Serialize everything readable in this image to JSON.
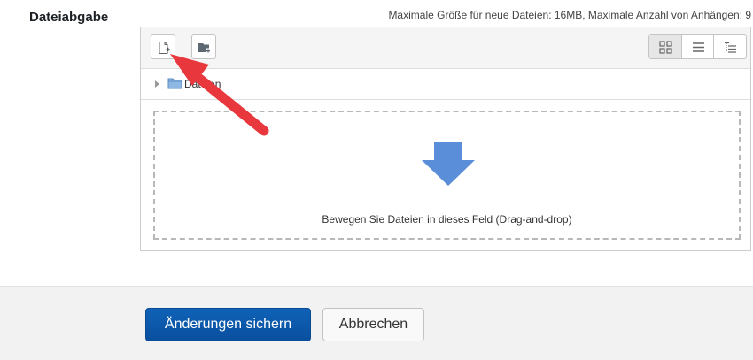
{
  "field": {
    "label": "Dateiabgabe",
    "limits": "Maximale Größe für neue Dateien: 16MB, Maximale Anzahl von Anhängen: 9"
  },
  "filepicker": {
    "toolbar": {
      "add_file_icon": "add-file-icon",
      "create_folder_icon": "create-folder-icon",
      "view_modes": [
        {
          "icon": "grid-view-icon",
          "active": true
        },
        {
          "icon": "list-view-icon",
          "active": false
        },
        {
          "icon": "tree-view-icon",
          "active": false
        }
      ]
    },
    "path": {
      "folder_label": "Dateien"
    },
    "dropzone": {
      "text": "Bewegen Sie Dateien in dieses Feld (Drag-and-drop)",
      "icon": "down-arrow-icon"
    }
  },
  "annotation": {
    "color": "#e8383d"
  },
  "footer": {
    "save_label": "Änderungen sichern",
    "cancel_label": "Abbrechen"
  },
  "colors": {
    "primary": "#0f62b8",
    "drop_arrow": "#5b8ed8"
  }
}
